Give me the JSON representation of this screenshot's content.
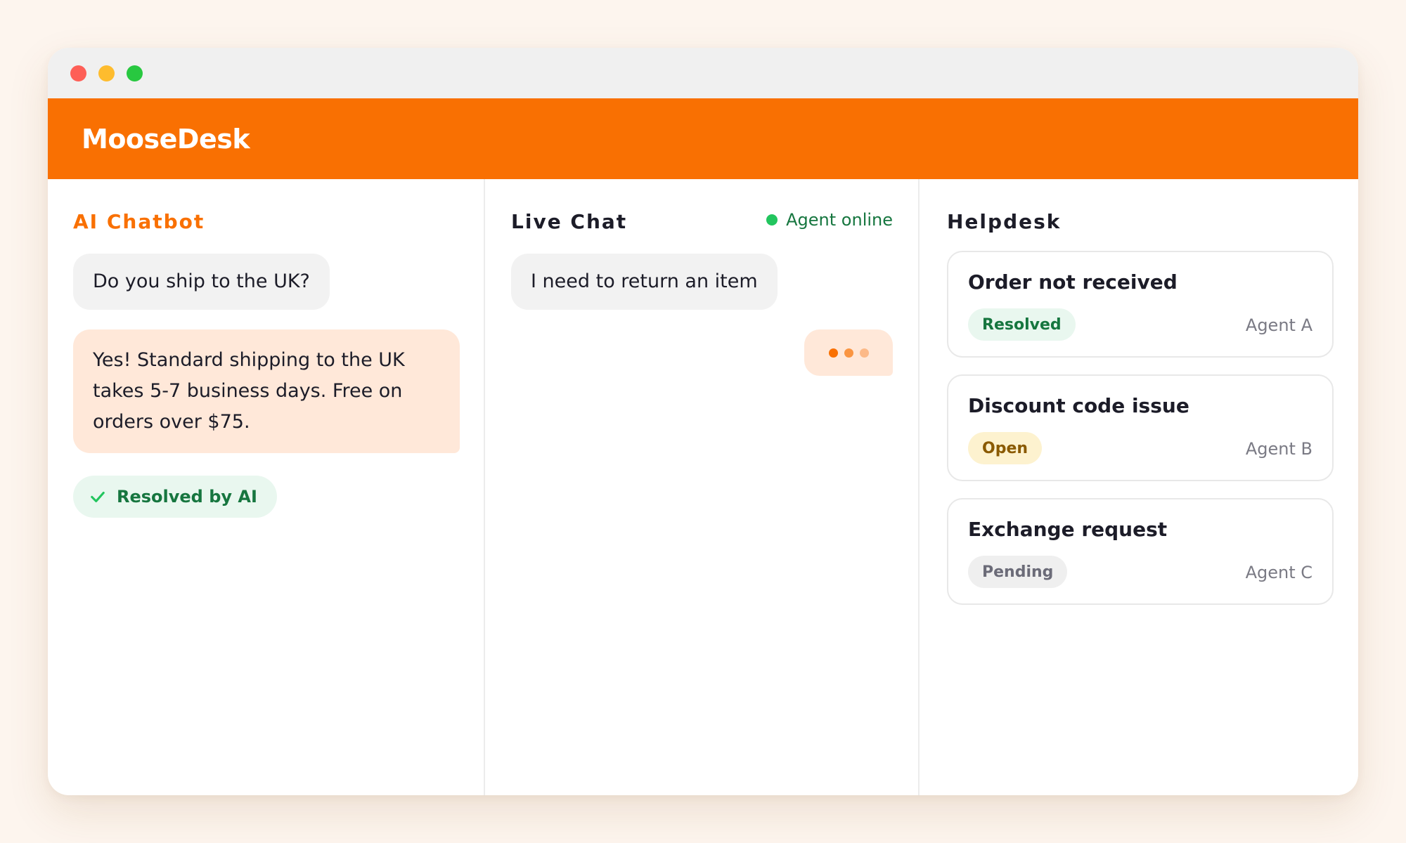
{
  "app": {
    "brand": "MooseDesk"
  },
  "colors": {
    "accent": "#f97002",
    "success": "#16763f",
    "bot_bubble": "#ffe8d9"
  },
  "chatbot": {
    "title": "AI Chatbot",
    "user_message": "Do you ship to the UK?",
    "bot_message": "Yes! Standard shipping to the UK takes 5-7 business days. Free on orders over $75.",
    "resolved_label": "Resolved by AI",
    "resolved_icon": "check-icon"
  },
  "livechat": {
    "title": "Live Chat",
    "status": "Agent online",
    "user_message": "I need to return an item",
    "typing_icon": "typing-indicator"
  },
  "helpdesk": {
    "title": "Helpdesk",
    "tickets": [
      {
        "title": "Order not received",
        "status": "Resolved",
        "agent": "Agent A"
      },
      {
        "title": "Discount code issue",
        "status": "Open",
        "agent": "Agent B"
      },
      {
        "title": "Exchange request",
        "status": "Pending",
        "agent": "Agent C"
      }
    ]
  }
}
